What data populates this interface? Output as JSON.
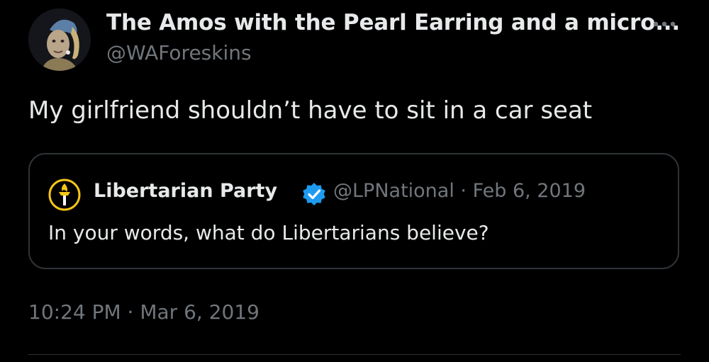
{
  "author": {
    "display_name": "The Amos with the Pearl Earring and a micro...",
    "handle": "@WAForeskins",
    "avatar_icon": "pearl-earring-portrait-avatar"
  },
  "tweet": {
    "text": "My girlfriend shouldn’t have to sit in a car seat",
    "timestamp": "10:24 PM · Mar 6, 2019"
  },
  "quoted_tweet": {
    "author_name": "Libertarian Party",
    "verified_icon": "verified-badge-icon",
    "meta": "@LPNational · Feb 6, 2019",
    "text": "In your words, what do Libertarians believe?",
    "avatar_icon": "torch-logo-icon"
  },
  "menu": {
    "more_icon": "more-options-icon"
  },
  "colors": {
    "background": "#000000",
    "primary_text": "#e7e9ea",
    "secondary_text": "#71767b",
    "border": "#2f3336",
    "verified_blue": "#1d9bf0",
    "lp_gold": "#f5c518"
  }
}
